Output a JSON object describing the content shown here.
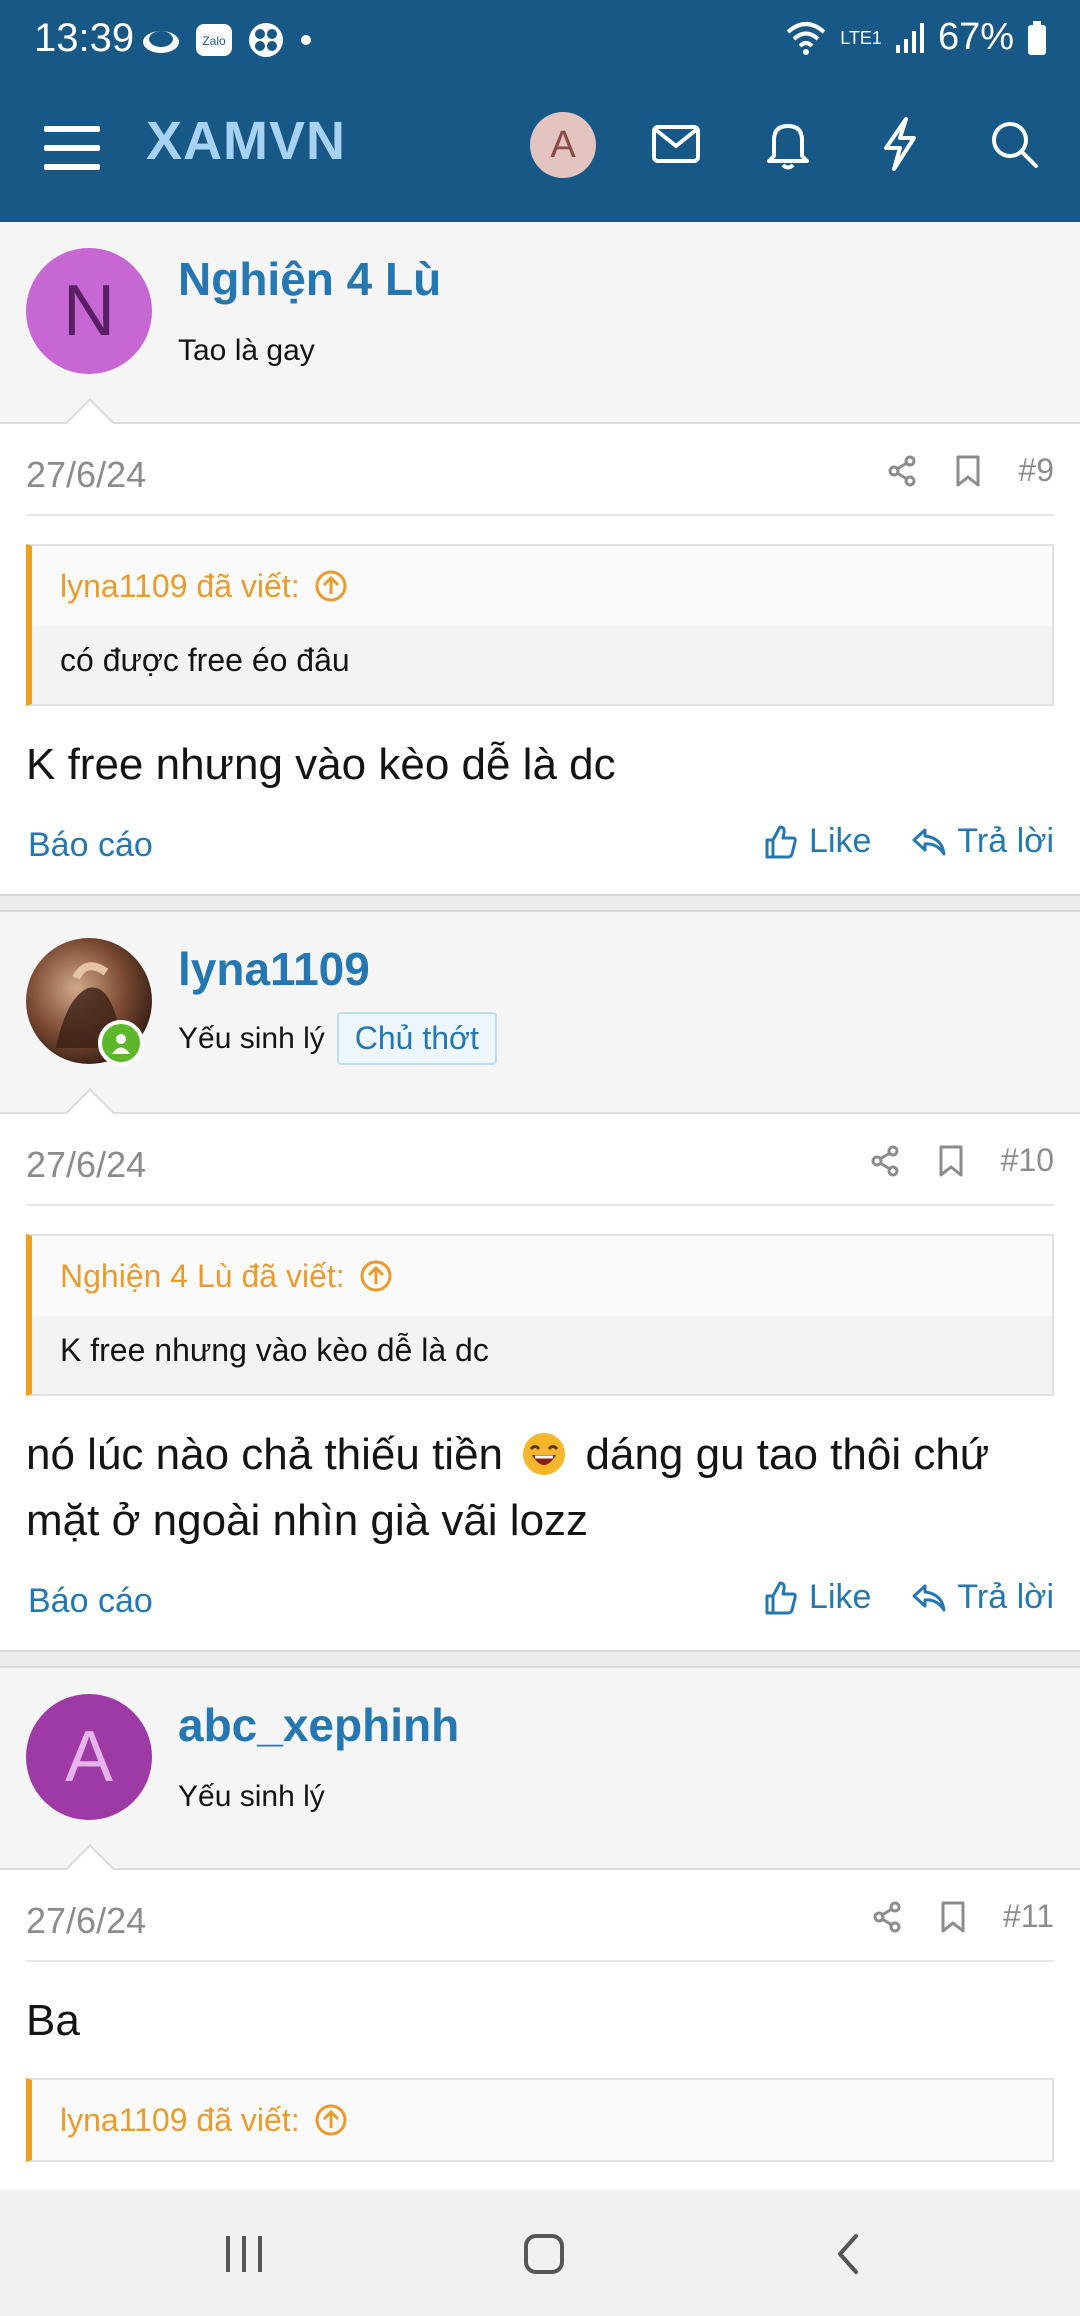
{
  "status_bar": {
    "time": "13:39",
    "battery": "67%",
    "network": "LTE1"
  },
  "app_bar": {
    "title": "XAMVN",
    "avatar_letter": "A",
    "icons": [
      "menu-icon",
      "mail-icon",
      "bell-icon",
      "lightning-icon",
      "search-icon"
    ]
  },
  "posts": [
    {
      "username": "Nghiện 4 Lù",
      "user_title": "Tao là gay",
      "avatar_letter": "N",
      "avatar_bg": "#c667d4",
      "avatar_fg": "#5b1f66",
      "date": "27/6/24",
      "number": "#9",
      "quote_author": "lyna1109 đã viết:",
      "quote_text": "có được free éo đâu",
      "message": "K free nhưng vào kèo dễ là dc",
      "report": "Báo cáo",
      "like": "Like",
      "reply": "Trả lời"
    },
    {
      "username": "lyna1109",
      "user_title": "Yếu sinh lý",
      "badge": "Chủ thớt",
      "date": "27/6/24",
      "number": "#10",
      "quote_author": "Nghiện 4 Lù đã viết:",
      "quote_text": "K free nhưng vào kèo dễ là dc",
      "message_part1": "nó lúc nào chả thiếu tiền",
      "message_part2": "dáng gu tao thôi chứ mặt ở ngoài nhìn già vãi lozz",
      "report": "Báo cáo",
      "like": "Like",
      "reply": "Trả lời"
    },
    {
      "username": "abc_xephinh",
      "user_title": "Yếu sinh lý",
      "avatar_letter": "A",
      "avatar_bg": "#9e3aa6",
      "avatar_fg": "#e8b4ec",
      "date": "27/6/24",
      "number": "#11",
      "message": "Ba",
      "quote_author": "lyna1109 đã viết:"
    }
  ],
  "colors": {
    "header": "#185886",
    "link": "#2577b1",
    "quote_accent": "#f0a020"
  }
}
